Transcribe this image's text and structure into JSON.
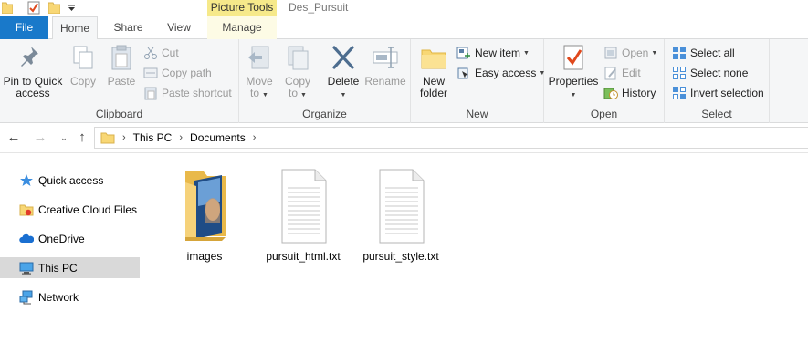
{
  "window": {
    "title": "Des_Pursuit",
    "context_tab_group": "Picture Tools"
  },
  "tabs": {
    "file": "File",
    "home": "Home",
    "share": "Share",
    "view": "View",
    "manage": "Manage"
  },
  "ribbon": {
    "clipboard": {
      "label": "Clipboard",
      "pin_line1": "Pin to Quick",
      "pin_line2": "access",
      "copy": "Copy",
      "paste": "Paste",
      "cut": "Cut",
      "copy_path": "Copy path",
      "paste_shortcut": "Paste shortcut"
    },
    "organize": {
      "label": "Organize",
      "move_line1": "Move",
      "move_line2": "to",
      "copy_line1": "Copy",
      "copy_line2": "to",
      "delete": "Delete",
      "rename": "Rename"
    },
    "new": {
      "label": "New",
      "folder_line1": "New",
      "folder_line2": "folder",
      "new_item": "New item",
      "easy_access": "Easy access"
    },
    "open": {
      "label": "Open",
      "properties": "Properties",
      "open": "Open",
      "edit": "Edit",
      "history": "History"
    },
    "select": {
      "label": "Select",
      "select_all": "Select all",
      "select_none": "Select none",
      "invert_selection": "Invert selection"
    }
  },
  "address": {
    "crumbs": [
      "This PC",
      "Documents"
    ]
  },
  "navpane": {
    "items": [
      {
        "label": "Quick access"
      },
      {
        "label": "Creative Cloud Files"
      },
      {
        "label": "OneDrive"
      },
      {
        "label": "This PC"
      },
      {
        "label": "Network"
      }
    ]
  },
  "files": [
    {
      "name": "images",
      "type": "folder"
    },
    {
      "name": "pursuit_html.txt",
      "type": "text"
    },
    {
      "name": "pursuit_style.txt",
      "type": "text"
    }
  ],
  "colors": {
    "file_tab": "#1979ca",
    "context_tab": "#f6e98a",
    "selection": "#d9d9d9",
    "ribbon_bg": "#f5f6f7"
  }
}
